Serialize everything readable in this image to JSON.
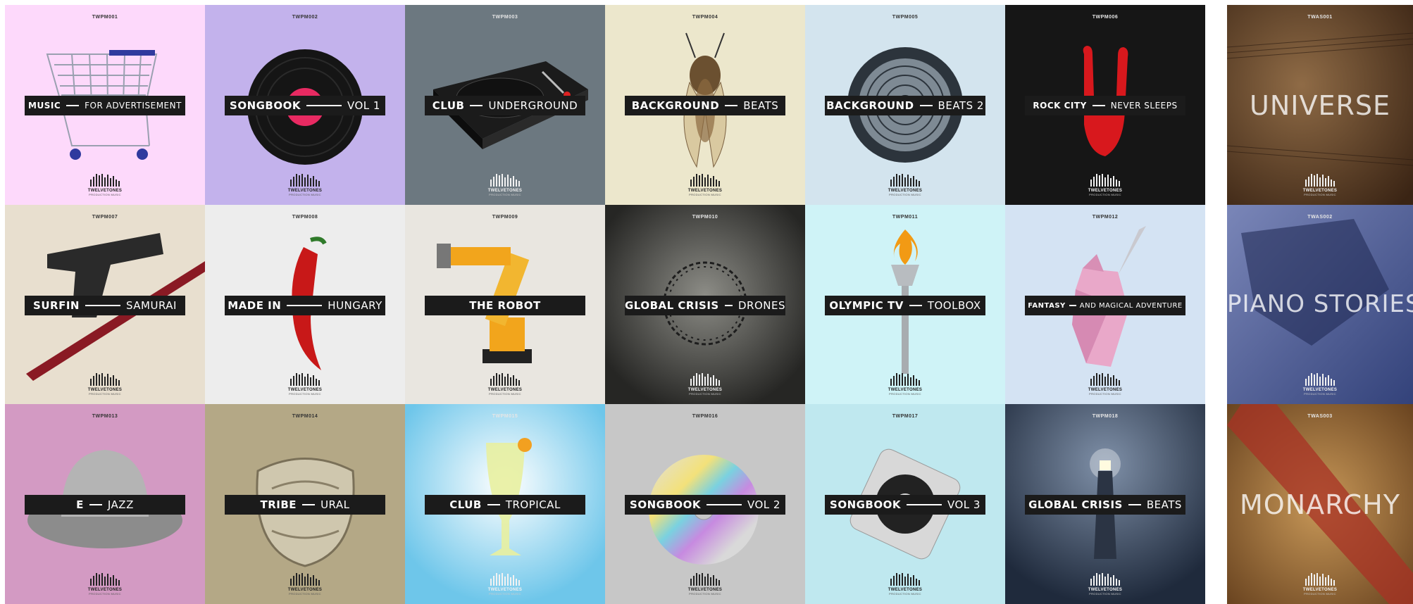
{
  "brand": {
    "name": "TWELVETONES",
    "sub": "PRODUCTION MUSIC"
  },
  "albums": [
    {
      "code": "TWPM001",
      "title": "MUSIC",
      "subtitle": "FOR ADVERTISEMENT",
      "bg": "#fdd9fb",
      "art": "shopping-cart-icon"
    },
    {
      "code": "TWPM002",
      "title": "SONGBOOK",
      "subtitle": "VOL 1",
      "bg": "#c3b2ec",
      "art": "vinyl-record-icon"
    },
    {
      "code": "TWPM003",
      "title": "CLUB",
      "subtitle": "UNDERGROUND",
      "bg": "#6c7880",
      "art": "turntable-icon"
    },
    {
      "code": "TWPM004",
      "title": "BACKGROUND",
      "subtitle": "BEATS",
      "bg": "#ece7cc",
      "art": "cicada-icon"
    },
    {
      "code": "TWPM005",
      "title": "BACKGROUND",
      "subtitle": "BEATS 2",
      "bg": "#d3e4ee",
      "art": "fan-icon"
    },
    {
      "code": "TWPM006",
      "title": "ROCK CITY",
      "subtitle": "NEVER SLEEPS",
      "bg": "#151515",
      "art": "rock-hand-icon"
    },
    {
      "code": "TWPM007",
      "title": "SURFIN",
      "subtitle": "SAMURAI",
      "bg": "#e8dfcf",
      "art": "pistol-katana-icon"
    },
    {
      "code": "TWPM008",
      "title": "MADE IN",
      "subtitle": "HUNGARY",
      "bg": "#ededed",
      "art": "chili-pepper-icon"
    },
    {
      "code": "TWPM009",
      "title": "THE ROBOT",
      "subtitle": "",
      "bg": "#e9e6e0",
      "art": "robot-arm-icon"
    },
    {
      "code": "TWPM010",
      "title": "GLOBAL CRISIS",
      "subtitle": "DRONES",
      "bg": "#4a4a46",
      "art": "barbed-wire-icon"
    },
    {
      "code": "TWPM011",
      "title": "OLYMPIC TV",
      "subtitle": "TOOLBOX",
      "bg": "#cff3f7",
      "art": "torch-icon"
    },
    {
      "code": "TWPM012",
      "title": "FANTASY",
      "subtitle": "AND MAGICAL ADVENTURE",
      "bg": "#d4e3f3",
      "art": "unicorn-icon"
    },
    {
      "code": "TWPM013",
      "title": "E",
      "subtitle": "JAZZ",
      "bg": "#d39ac3",
      "art": "fedora-hat-icon"
    },
    {
      "code": "TWPM014",
      "title": "TRIBE",
      "subtitle": "URAL",
      "bg": "#b4a886",
      "art": "ornate-bowl-icon"
    },
    {
      "code": "TWPM015",
      "title": "CLUB",
      "subtitle": "TROPICAL",
      "bg": "#8fd3ee",
      "art": "cocktail-icon"
    },
    {
      "code": "TWPM016",
      "title": "SONGBOOK",
      "subtitle": "VOL 2",
      "bg": "#c7c7c7",
      "art": "compact-disc-icon"
    },
    {
      "code": "TWPM017",
      "title": "SONGBOOK",
      "subtitle": "VOL 3",
      "bg": "#bfe8ef",
      "art": "music-player-icon"
    },
    {
      "code": "TWPM018",
      "title": "GLOBAL CRISIS",
      "subtitle": "BEATS",
      "bg": "#394a62",
      "art": "lighthouse-icon"
    }
  ],
  "side_albums": [
    {
      "code": "TWAS001",
      "title": "UNIVERSE",
      "bg": "#6b4a30",
      "art": "sheet-music-texture-icon"
    },
    {
      "code": "TWAS002",
      "title": "PIANO STORIES",
      "bg": "#4d5f9e",
      "art": "piano-shadow-icon"
    },
    {
      "code": "TWAS003",
      "title": "MONARCHY",
      "bg": "#a0703e",
      "art": "royal-sash-icon"
    }
  ]
}
